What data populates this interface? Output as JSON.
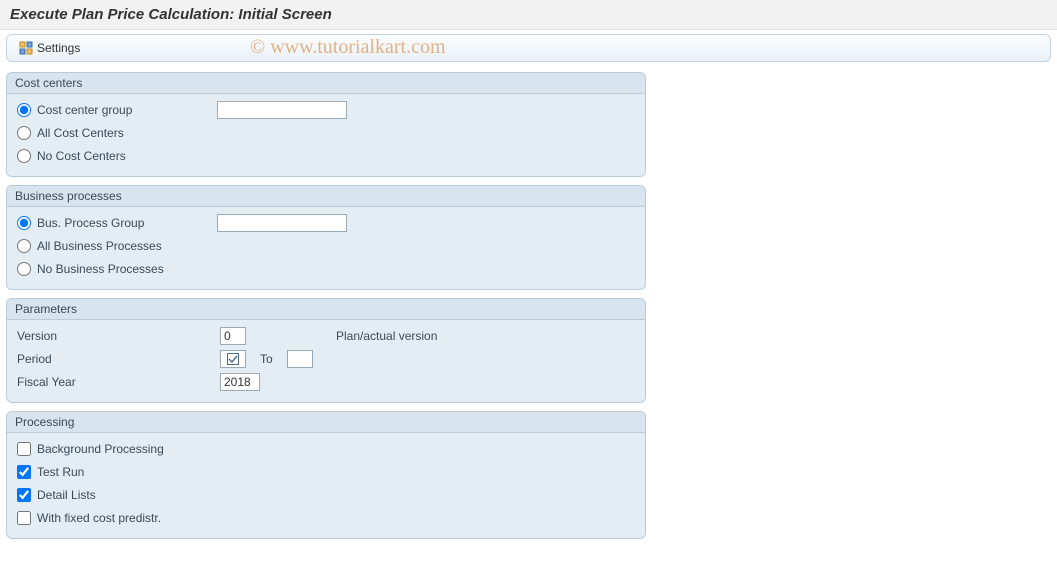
{
  "title": "Execute Plan Price Calculation: Initial Screen",
  "toolbar": {
    "settings_label": "Settings"
  },
  "watermark": "© www.tutorialkart.com",
  "groups": {
    "cost_centers": {
      "title": "Cost centers",
      "opt_group": "Cost center group",
      "opt_all": "All Cost Centers",
      "opt_none": "No Cost Centers",
      "group_value": ""
    },
    "business_processes": {
      "title": "Business processes",
      "opt_group": "Bus. Process Group",
      "opt_all": "All Business Processes",
      "opt_none": "No Business Processes",
      "group_value": ""
    },
    "parameters": {
      "title": "Parameters",
      "version_label": "Version",
      "version_value": "0",
      "version_note": "Plan/actual version",
      "period_label": "Period",
      "period_from": "",
      "to_label": "To",
      "period_to": "",
      "fiscal_year_label": "Fiscal Year",
      "fiscal_year_value": "2018"
    },
    "processing": {
      "title": "Processing",
      "background": "Background Processing",
      "test_run": "Test Run",
      "detail_lists": "Detail Lists",
      "fixed_cost": "With fixed cost predistr."
    }
  }
}
